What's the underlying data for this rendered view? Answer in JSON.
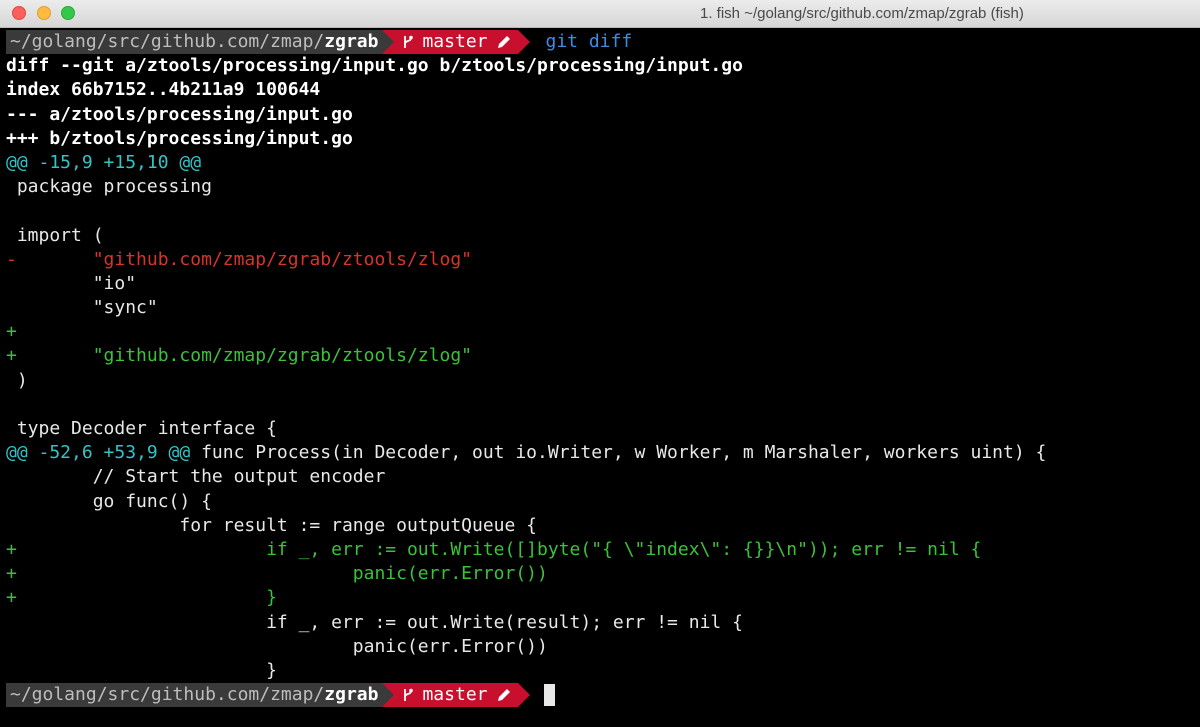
{
  "window": {
    "title": "1. fish ~/golang/src/github.com/zmap/zgrab (fish)"
  },
  "prompt": {
    "path_prefix": "~/golang/src/github.com/zmap/",
    "current_dir": "zgrab",
    "branch": "master",
    "branch_icon": "git-branch-icon",
    "dirty_icon": "pencil-icon",
    "command": "git diff"
  },
  "diff_lines": [
    {
      "kind": "header",
      "text": "diff --git a/ztools/processing/input.go b/ztools/processing/input.go"
    },
    {
      "kind": "header",
      "text": "index 66b7152..4b211a9 100644"
    },
    {
      "kind": "header",
      "text": "--- a/ztools/processing/input.go"
    },
    {
      "kind": "header",
      "text": "+++ b/ztools/processing/input.go"
    },
    {
      "kind": "hunk",
      "hunk": "@@ -15,9 +15,10 @@",
      "text": ""
    },
    {
      "kind": "context",
      "text": " package processing"
    },
    {
      "kind": "context",
      "text": ""
    },
    {
      "kind": "context",
      "text": " import ("
    },
    {
      "kind": "removed",
      "marker": "-",
      "text": "       \"github.com/zmap/zgrab/ztools/zlog\""
    },
    {
      "kind": "context",
      "text": "        \"io\""
    },
    {
      "kind": "context",
      "text": "        \"sync\""
    },
    {
      "kind": "added",
      "marker": "+",
      "text": ""
    },
    {
      "kind": "added",
      "marker": "+",
      "text": "       \"github.com/zmap/zgrab/ztools/zlog\""
    },
    {
      "kind": "context",
      "text": " )"
    },
    {
      "kind": "context",
      "text": ""
    },
    {
      "kind": "context",
      "text": " type Decoder interface {"
    },
    {
      "kind": "hunk",
      "hunk": "@@ -52,6 +53,9 @@",
      "text": " func Process(in Decoder, out io.Writer, w Worker, m Marshaler, workers uint) {"
    },
    {
      "kind": "context",
      "text": "        // Start the output encoder"
    },
    {
      "kind": "context",
      "text": "        go func() {"
    },
    {
      "kind": "context",
      "text": "                for result := range outputQueue {"
    },
    {
      "kind": "added",
      "marker": "+",
      "text": "                       if _, err := out.Write([]byte(\"{ \\\"index\\\": {}}\\n\")); err != nil {"
    },
    {
      "kind": "added",
      "marker": "+",
      "text": "                               panic(err.Error())"
    },
    {
      "kind": "added",
      "marker": "+",
      "text": "                       }"
    },
    {
      "kind": "context",
      "text": "                        if _, err := out.Write(result); err != nil {"
    },
    {
      "kind": "context",
      "text": "                                panic(err.Error())"
    },
    {
      "kind": "context",
      "text": "                        }"
    }
  ],
  "colors": {
    "background": "#000000",
    "path_segment": "#3a3a3a",
    "git_segment": "#c8102e",
    "removed": "#d7342b",
    "added": "#3cc13b",
    "hunk": "#33c3c8",
    "command": "#3a8ee6"
  }
}
